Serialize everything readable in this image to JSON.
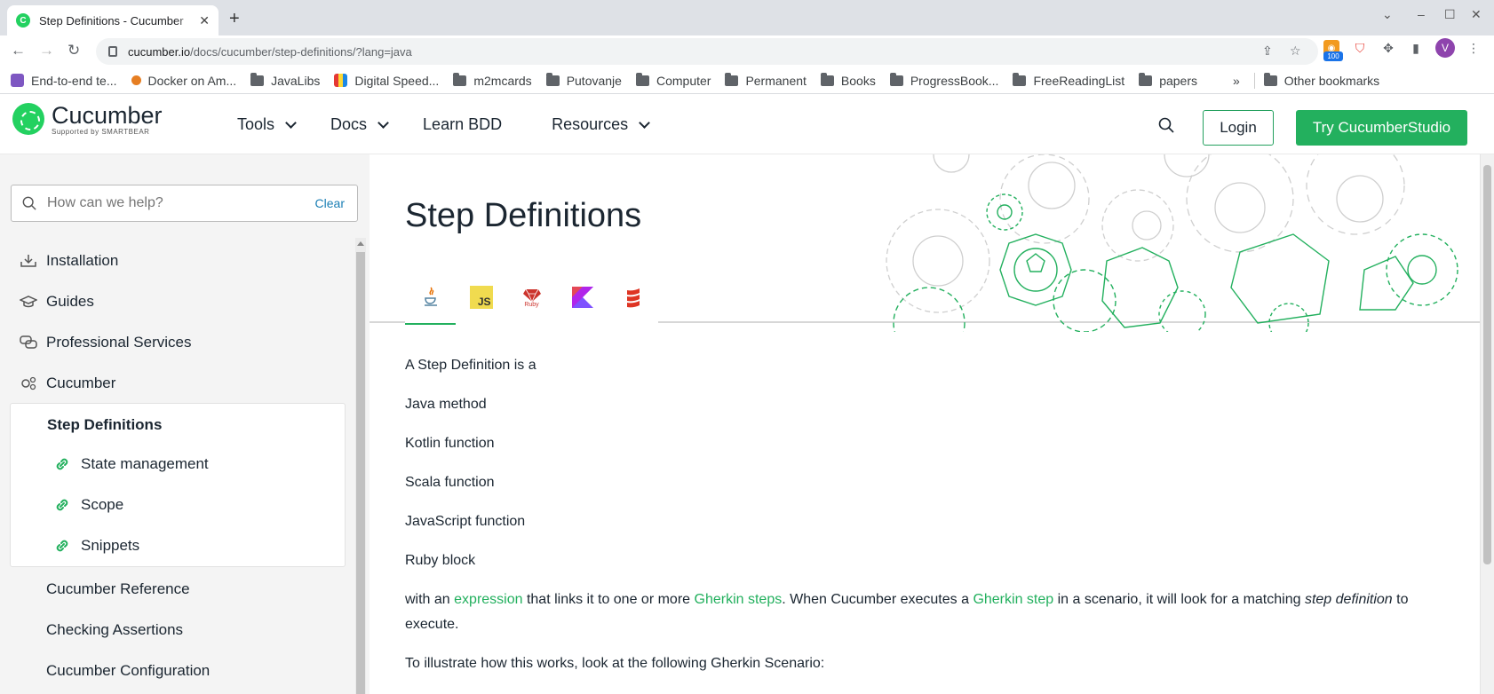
{
  "browser": {
    "tab_title": "Step Definitions - Cucumber",
    "url_host": "cucumber.io",
    "url_path": "/docs/cucumber/step-definitions/?lang=java",
    "ext_badge": "100",
    "profile_initial": "V"
  },
  "bookmarks": [
    {
      "label": "End-to-end te...",
      "kind": "site"
    },
    {
      "label": "Docker on Am...",
      "kind": "site"
    },
    {
      "label": "JavaLibs",
      "kind": "folder"
    },
    {
      "label": "Digital Speed...",
      "kind": "site"
    },
    {
      "label": "m2mcards",
      "kind": "folder"
    },
    {
      "label": "Putovanje",
      "kind": "folder"
    },
    {
      "label": "Computer",
      "kind": "folder"
    },
    {
      "label": "Permanent",
      "kind": "folder"
    },
    {
      "label": "Books",
      "kind": "folder"
    },
    {
      "label": "ProgressBook...",
      "kind": "folder"
    },
    {
      "label": "FreeReadingList",
      "kind": "folder"
    },
    {
      "label": "papers",
      "kind": "folder"
    }
  ],
  "bookmarks_overflow": "»",
  "other_bookmarks": "Other bookmarks",
  "header": {
    "logo_name": "Cucumber",
    "logo_sub": "Supported by SMARTBEAR",
    "nav": [
      "Tools",
      "Docs",
      "Learn BDD",
      "Resources"
    ],
    "login": "Login",
    "try": "Try CucumberStudio"
  },
  "sidebar": {
    "search_placeholder": "How can we help?",
    "clear": "Clear",
    "items": [
      "Installation",
      "Guides",
      "Professional Services",
      "Cucumber"
    ],
    "active_section": "Step Definitions",
    "sub_links": [
      "State management",
      "Scope",
      "Snippets"
    ],
    "more_items": [
      "Cucumber Reference",
      "Checking Assertions",
      "Cucumber Configuration"
    ]
  },
  "main": {
    "title": "Step Definitions",
    "lang_tabs": [
      "java",
      "JS",
      "Ruby",
      "kotlin",
      "scala"
    ],
    "intro": "A Step Definition is a",
    "kinds": [
      "Java method",
      "Kotlin function",
      "Scala function",
      "JavaScript function",
      "Ruby block"
    ],
    "para1": {
      "a": "with an ",
      "link1": "expression",
      "b": " that links it to one or more ",
      "link2": "Gherkin steps",
      "c": ". When Cucumber executes a ",
      "link3": "Gherkin step",
      "d": " in a scenario, it will look for a matching ",
      "em": "step definition",
      "e": " to execute."
    },
    "para2": "To illustrate how this works, look at the following Gherkin Scenario:"
  },
  "colors": {
    "brand_green": "#23b05e",
    "text_dark": "#1b2631"
  }
}
